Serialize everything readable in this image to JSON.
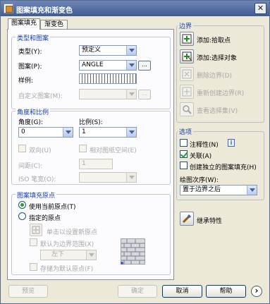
{
  "window": {
    "title": "图案填充和渐变色",
    "close_glyph": "✕"
  },
  "tabs": [
    {
      "label": "图案填充"
    },
    {
      "label": "渐变色"
    }
  ],
  "type_pattern": {
    "group_label": "类型和图案",
    "type_label": "类型(Y):",
    "type_value": "预定义",
    "pattern_label": "图案(P):",
    "pattern_value": "ANGLE",
    "browse_label": "...",
    "swatch_label": "样例:",
    "custom_label": "自定义图案(M):",
    "custom_browse_label": "..."
  },
  "angle_scale": {
    "group_label": "角度和比例",
    "angle_label": "角度(G):",
    "angle_value": "0",
    "scale_label": "比例(S):",
    "scale_value": "1",
    "double_label": "双向(U)",
    "relative_label": "相对图纸空间(E)",
    "spacing_label": "间距(C):",
    "spacing_value": "1",
    "iso_label": "ISO 笔宽(O):"
  },
  "origin": {
    "group_label": "图案填充原点",
    "use_current_label": "使用当前原点(T)",
    "specified_label": "指定的原点",
    "click_set_label": "单击以设置新原点",
    "default_extents_label": "默认为边界范围(X)",
    "position_value": "左下",
    "store_default_label": "存储为默认原点(F)"
  },
  "boundaries": {
    "group_label": "边界",
    "add_pick_label": "添加:拾取点",
    "add_select_label": "添加:选择对象",
    "remove_label": "删除边界(D)",
    "recreate_label": "重新创建边界(R)",
    "view_label": "查看选择集(V)"
  },
  "options": {
    "group_label": "选项",
    "annotative_label": "注释性(N)",
    "info_glyph": "i",
    "associative_label": "关联(A)",
    "separate_label": "创建独立的图案填充(H)",
    "draw_order_label": "绘图次序(W):",
    "draw_order_value": "置于边界之后"
  },
  "inherit_label": "继承特性",
  "footer": {
    "preview_label": "预览",
    "ok_label": "确定",
    "cancel_label": "取消",
    "help_label": "帮助",
    "more_glyph": "›"
  },
  "colors": {
    "group_title": "#1440b4",
    "title_bar": "#3f5c93",
    "window_bg": "#ece9d8"
  },
  "icons": [
    "dialog-icon",
    "close-icon",
    "add-pick-icon",
    "add-select-icon",
    "remove-boundary-icon",
    "recreate-boundary-icon",
    "view-selection-icon",
    "inherit-icon",
    "origin-icon",
    "origin-preview-icon",
    "info-icon",
    "more-options-icon"
  ]
}
